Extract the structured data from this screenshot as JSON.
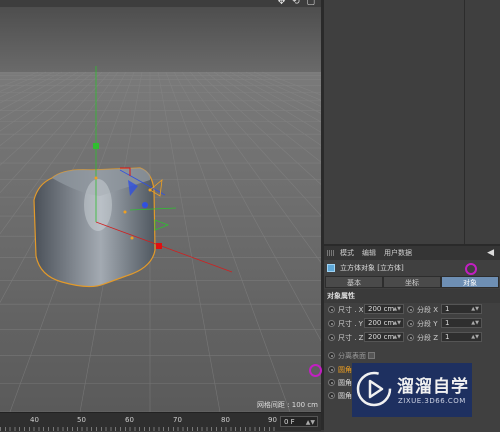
{
  "viewport": {
    "nav_icons": "✥ ⟲ ▢",
    "grid_spacing_label": "网格间距 : 100 cm"
  },
  "timeline": {
    "ticks": [
      "40",
      "50",
      "60",
      "70",
      "80",
      "90"
    ],
    "frame_value": "0 F"
  },
  "attributes": {
    "menu": [
      "模式",
      "编辑",
      "用户数据"
    ],
    "back_arrow": "◀",
    "object_title": "立方体对象 [立方体]",
    "tabs": [
      "基本",
      "坐标",
      "对象"
    ],
    "active_tab": "对象",
    "section_title": "对象属性",
    "size_x_label": "尺寸 . X",
    "size_x_value": "200 cm",
    "size_y_label": "尺寸 . Y",
    "size_y_value": "200 cm",
    "size_z_label": "尺寸 . Z",
    "size_z_value": "200 cm",
    "seg_x_label": "分段 X",
    "seg_x_value": "1",
    "seg_y_label": "分段 Y",
    "seg_y_value": "1",
    "seg_z_label": "分段 Z",
    "seg_z_value": "1",
    "separate_surfaces_label": "分离表面",
    "fillet_1": "圆角",
    "fillet_2": "圆角",
    "fillet_3": "圆角"
  },
  "watermark": {
    "brand": "溜溜自学",
    "url": "ZIXUE.3D66.COM"
  },
  "colors": {
    "accent_tab": "#6e8fb4",
    "highlight_circle": "#c21fc2",
    "selection_outline": "#f0a020"
  }
}
